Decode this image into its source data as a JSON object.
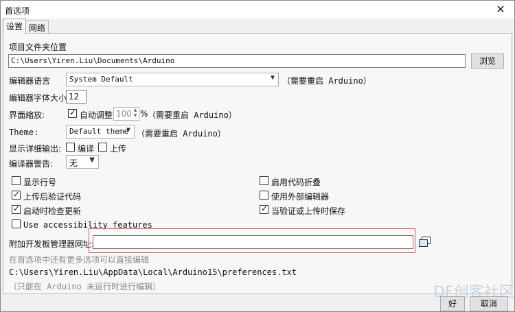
{
  "window": {
    "title": "首选项",
    "close_glyph": "✕"
  },
  "tabs": [
    {
      "label": "设置"
    },
    {
      "label": "网络"
    }
  ],
  "sketchbook": {
    "label": "项目文件夹位置",
    "path": "C:\\Users\\Yiren.Liu\\Documents\\Arduino",
    "browse_label": "浏览"
  },
  "editor_language": {
    "label": "编辑器语言",
    "value": "System Default",
    "note": "（需要重启 Arduino）"
  },
  "font_size": {
    "label": "编辑器字体大小",
    "value": "12"
  },
  "scale": {
    "label": "界面缩放:",
    "auto_label": "自动调整",
    "auto_checked": true,
    "percent": "100",
    "percent_sign": "%",
    "note": "（需要重启 Arduino）"
  },
  "theme": {
    "label": "Theme:",
    "value": "Default theme",
    "note": "（需要重启 Arduino）"
  },
  "verbose": {
    "label": "显示详细输出:",
    "compile_label": "编译",
    "compile_checked": false,
    "upload_label": "上传",
    "upload_checked": false
  },
  "warnings": {
    "label": "编译器警告:",
    "value": "无"
  },
  "options": {
    "line_numbers": {
      "label": "显示行号",
      "checked": false
    },
    "code_folding": {
      "label": "启用代码折叠",
      "checked": false
    },
    "verify_upload": {
      "label": "上传后验证代码",
      "checked": true
    },
    "external_editor": {
      "label": "使用外部编辑器",
      "checked": false
    },
    "check_updates": {
      "label": "启动时检查更新",
      "checked": true
    },
    "save_on_verify": {
      "label": "当验证或上传时保存",
      "checked": true
    },
    "accessibility": {
      "label": "Use accessibility features",
      "checked": false
    }
  },
  "board_manager": {
    "label": "附加开发板管理器网址:",
    "value": ""
  },
  "footer": {
    "more_prefs": "在首选项中还有更多选项可以直接编辑",
    "prefs_path": "C:\\Users\\Yiren.Liu\\AppData\\Local\\Arduino15\\preferences.txt",
    "edit_note": "（只能在 Arduino 未运行时进行编辑）"
  },
  "buttons": {
    "ok": "好",
    "cancel": "取消"
  },
  "watermark": "DF创客社区"
}
